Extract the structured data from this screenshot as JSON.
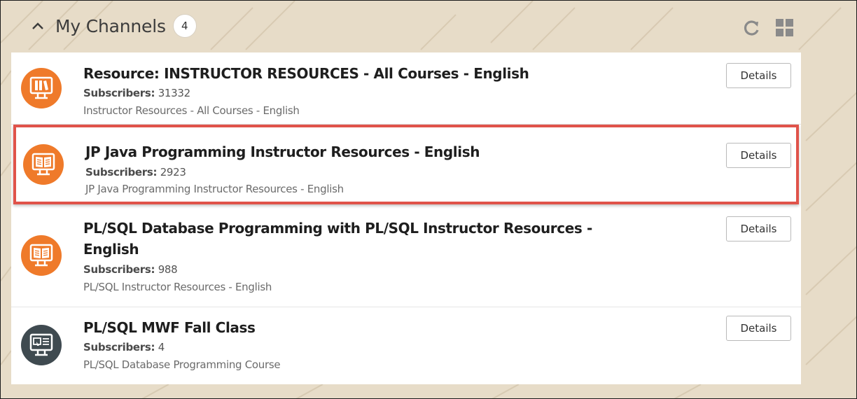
{
  "header": {
    "title": "My Channels",
    "count": "4",
    "collapse_icon": "chevron-up-icon",
    "refresh_icon": "refresh-icon",
    "grid_icon": "grid-view-icon"
  },
  "colors": {
    "orange": "#ef7a2a",
    "dark": "#3f4a50",
    "highlight_border": "#e0534a"
  },
  "channels": [
    {
      "title": "Resource: INSTRUCTOR RESOURCES - All Courses - English",
      "subscribers_label": "Subscribers:",
      "subscribers": "31332",
      "description": "Instructor Resources - All Courses - English",
      "button": "Details",
      "icon": "resource-library-icon"
    },
    {
      "title": "JP Java Programming Instructor Resources - English",
      "subscribers_label": "Subscribers:",
      "subscribers": "2923",
      "description": "JP Java Programming Instructor Resources - English",
      "button": "Details",
      "icon": "book-icon"
    },
    {
      "title": "PL/SQL Database Programming with PL/SQL Instructor Resources - English",
      "subscribers_label": "Subscribers:",
      "subscribers": "988",
      "description": "PL/SQL Instructor Resources - English",
      "button": "Details",
      "icon": "book-icon"
    },
    {
      "title": "PL/SQL MWF Fall Class",
      "subscribers_label": "Subscribers:",
      "subscribers": "4",
      "description": "PL/SQL Database Programming Course",
      "button": "Details",
      "icon": "class-screen-icon"
    }
  ]
}
